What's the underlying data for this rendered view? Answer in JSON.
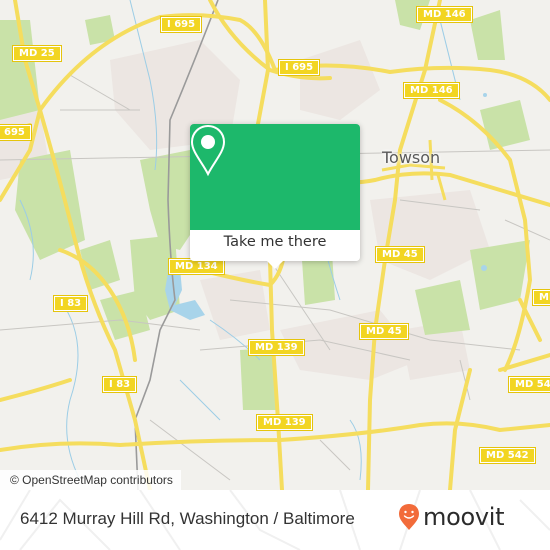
{
  "map": {
    "city_labels": [
      {
        "name": "Towson"
      }
    ],
    "road_shields": [
      {
        "label": "I 695"
      },
      {
        "label": "MD 25"
      },
      {
        "label": "695"
      },
      {
        "label": "MD 146"
      },
      {
        "label": "I 695"
      },
      {
        "label": "MD 146"
      },
      {
        "label": "MD 134"
      },
      {
        "label": "MD 45"
      },
      {
        "label": "I 83"
      },
      {
        "label": "MD 45"
      },
      {
        "label": "MD 139"
      },
      {
        "label": "I 83"
      },
      {
        "label": "MD 542"
      },
      {
        "label": "MD 139"
      },
      {
        "label": "MD 542"
      },
      {
        "label": "MD"
      }
    ],
    "attribution": "© OpenStreetMap contributors"
  },
  "popup": {
    "icon": "map-pin-icon",
    "action_label": "Take me there",
    "color": "#1db86b"
  },
  "footer": {
    "address": "6412 Murray Hill Rd, Washington / Baltimore",
    "brand": "moovit",
    "brand_color": "#f26b3a"
  }
}
